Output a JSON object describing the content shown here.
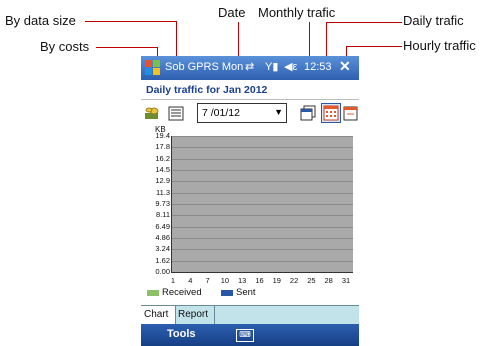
{
  "callouts": {
    "by_data_size": "By data size",
    "by_costs": "By costs",
    "date": "Date",
    "monthly_traffic": "Monthly trafic",
    "daily_traffic": "Daily trafic",
    "hourly_traffic": "Hourly traffic"
  },
  "titlebar": {
    "title": "Sob GPRS Mon",
    "clock": "12:53",
    "close": "✕"
  },
  "subtitle": "Daily traffic for Jan 2012",
  "date_picker": {
    "value": "7 /01/12"
  },
  "chart_data": {
    "type": "bar",
    "ylabel": "KB",
    "y_ticks": [
      "19.4",
      "17.8",
      "16.2",
      "14.5",
      "12.9",
      "11.3",
      "9.73",
      "8.11",
      "6.49",
      "4.86",
      "3.24",
      "1.62",
      "0.00"
    ],
    "x_ticks": [
      "1",
      "4",
      "7",
      "10",
      "13",
      "16",
      "19",
      "22",
      "25",
      "28",
      "31"
    ],
    "ylim": [
      0,
      19.4
    ],
    "series": [
      {
        "name": "Received",
        "color": "#8dbf66"
      },
      {
        "name": "Sent",
        "color": "#2b57a8"
      }
    ],
    "grid": true,
    "legend": "bottom-left"
  },
  "tabs": [
    "Chart",
    "Report"
  ],
  "softkeys": {
    "left": "Tools"
  },
  "colors": {
    "callout_line": "#c00000",
    "title_bar": "#3a6fc4",
    "plot_bg": "#a9a9a9",
    "tab_bar": "#c3e3ea"
  }
}
